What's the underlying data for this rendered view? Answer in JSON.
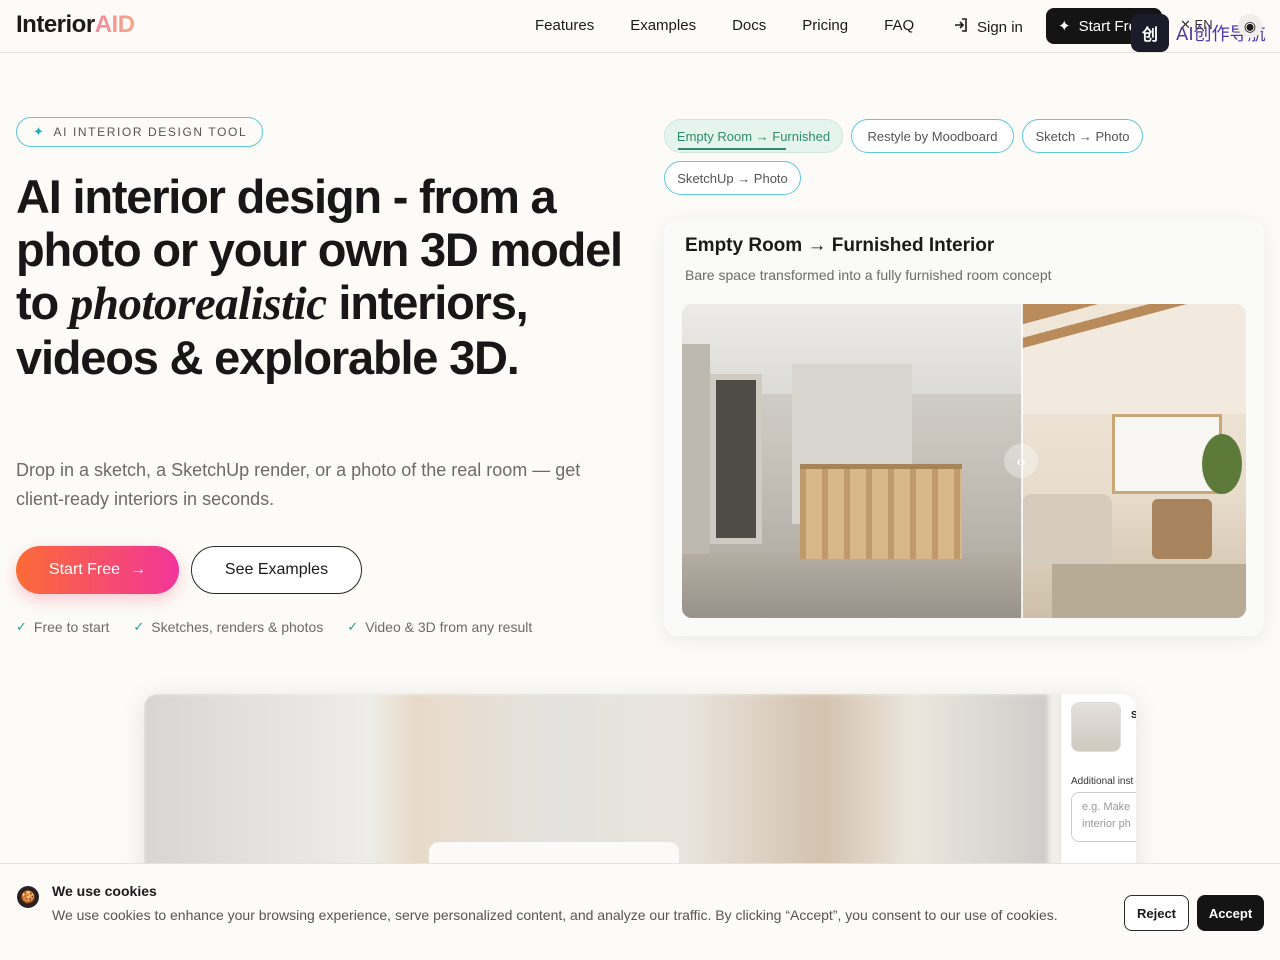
{
  "nav": {
    "logo_main": "Interior",
    "logo_accent": "AID",
    "links": [
      "Features",
      "Examples",
      "Docs",
      "Pricing",
      "FAQ"
    ],
    "signin_label": "Sign in",
    "start_label": "Start Free",
    "lang_label": "EN",
    "extension_text": "AI创作导航"
  },
  "hero": {
    "badge": "AI INTERIOR DESIGN TOOL",
    "headline_part1": "AI interior design - from a photo or your own 3D model to ",
    "headline_emph": "photorealistic",
    "headline_part2": " interiors, videos & explorable 3D.",
    "subhead": "Drop in a sketch, a SketchUp render, or a photo of the real room — get client-ready interiors in seconds.",
    "primary_cta": "Start Free",
    "secondary_cta": "See Examples",
    "perks": [
      "Free to start",
      "Sketches, renders & photos",
      "Video & 3D from any result"
    ]
  },
  "modes": {
    "chips": [
      "Empty Room → Furnished",
      "Restyle by Moodboard",
      "Sketch → Photo",
      "SketchUp → Photo"
    ],
    "active_index": 0
  },
  "showcase": {
    "title": "Empty Room → Furnished Interior",
    "subtitle": "Bare space transformed into a fully furnished room concept"
  },
  "preview": {
    "thumb_initial": "S",
    "instructions_label": "Additional inst",
    "instructions_placeholder": "e.g. Make interior ph"
  },
  "cookie": {
    "title": "We use cookies",
    "text": "We use cookies to enhance your browsing experience, serve personalized content, and analyze our traffic. By clicking “Accept”, you consent to our use of cookies.",
    "reject_label": "Reject",
    "accept_label": "Accept"
  },
  "colors": {
    "accent_gradient_start": "#fb6b36",
    "accent_gradient_end": "#f2359a",
    "chip_border": "#5fc7d8",
    "active_chip_bg": "#e6f4ee",
    "check": "#2a9d8f"
  }
}
